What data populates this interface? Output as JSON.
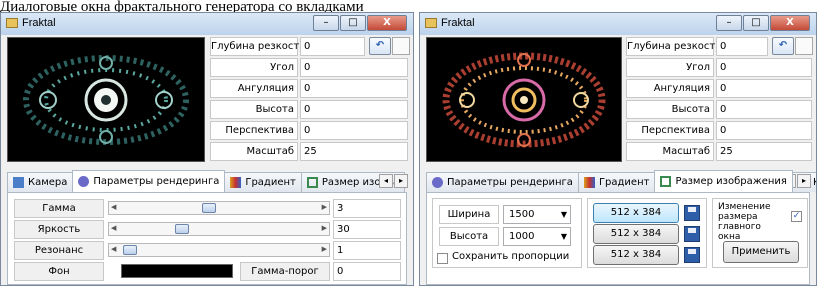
{
  "caption": "Диалоговые окна фрактального генератора со вкладками",
  "windows": [
    {
      "title": "Fraktal",
      "controls": {
        "minimize": "–",
        "maximize": "□",
        "close": "X"
      },
      "props": [
        {
          "label": "Глубина резкости",
          "value": "0"
        },
        {
          "label": "Угол",
          "value": "0"
        },
        {
          "label": "Ангуляция",
          "value": "0"
        },
        {
          "label": "Высота",
          "value": "0"
        },
        {
          "label": "Перспектива",
          "value": "0"
        },
        {
          "label": "Масштаб",
          "value": "25"
        }
      ],
      "tabs": [
        {
          "label": "Камера",
          "icon": "camera-icon",
          "color": "#4a7ec8",
          "active": false
        },
        {
          "label": "Параметры рендеринга",
          "icon": "gear-icon",
          "color": "#6a6ac8",
          "active": true
        },
        {
          "label": "Градиент",
          "icon": "gradient-icon",
          "color": "#d8a020",
          "active": false
        },
        {
          "label": "Размер изобра",
          "icon": "resize-icon",
          "color": "#3a8a50",
          "active": false
        }
      ],
      "render": {
        "gamma": {
          "label": "Гамма",
          "value": "3",
          "level": 0.42
        },
        "brightness": {
          "label": "Яркость",
          "value": "30",
          "level": 0.3
        },
        "resonance": {
          "label": "Резонанс",
          "value": "1",
          "level": 0.05
        },
        "background": {
          "label": "Фон",
          "color": "#000000"
        },
        "gamma_threshold": {
          "label": "Гамма-порог",
          "value": "0"
        }
      }
    },
    {
      "title": "Fraktal",
      "controls": {
        "minimize": "–",
        "maximize": "□",
        "close": "X"
      },
      "props": [
        {
          "label": "Глубина резкости",
          "value": "0"
        },
        {
          "label": "Угол",
          "value": "0"
        },
        {
          "label": "Ангуляция",
          "value": "0"
        },
        {
          "label": "Высота",
          "value": "0"
        },
        {
          "label": "Перспектива",
          "value": "0"
        },
        {
          "label": "Масштаб",
          "value": "25"
        }
      ],
      "tabs": [
        {
          "label": "Параметры рендеринга",
          "icon": "gear-icon",
          "color": "#6a6ac8",
          "active": false
        },
        {
          "label": "Градиент",
          "icon": "gradient-icon",
          "color": "#d8a020",
          "active": false
        },
        {
          "label": "Размер изображения",
          "icon": "resize-icon",
          "color": "#3a8a50",
          "active": true
        },
        {
          "label": "К",
          "icon": "color-icon",
          "color": "#20a060",
          "active": false
        }
      ],
      "size": {
        "width_label": "Ширина",
        "width_value": "1500",
        "height_label": "Высота",
        "height_value": "1000",
        "keep_aspect_label": "Сохранить пропорции",
        "keep_aspect_checked": false,
        "presets": [
          "512 x 384",
          "512 x 384",
          "512 x 384"
        ],
        "resize_window_label": "Изменение размера главного окна",
        "resize_window_checked": true,
        "apply_label": "Применить"
      }
    }
  ]
}
